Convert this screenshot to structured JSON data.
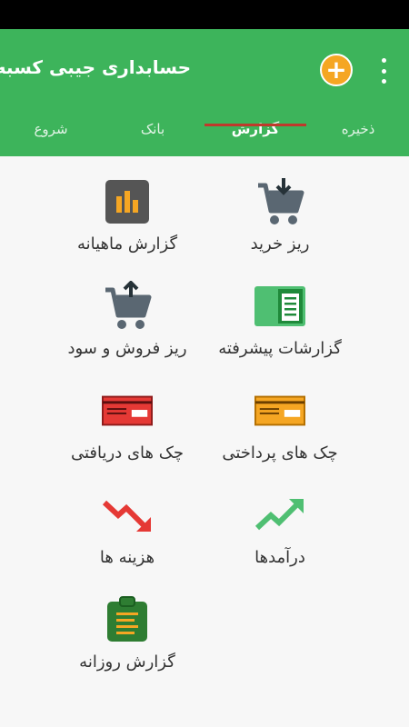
{
  "app": {
    "title": "حسابداری جیبی کسبه"
  },
  "toolbar": {
    "add_icon": "plus-circle-icon",
    "menu_icon": "more-vert-icon"
  },
  "tabs": [
    {
      "label": "ذخیره",
      "active": false
    },
    {
      "label": "گزارش",
      "active": true
    },
    {
      "label": "بانک",
      "active": false
    },
    {
      "label": "شروع",
      "active": false
    }
  ],
  "grid": {
    "items": [
      {
        "label": "ریز خرید",
        "icon": "cart-in-icon"
      },
      {
        "label": "گزارش ماهیانه",
        "icon": "bar-chart-icon"
      },
      {
        "label": "گزارشات پیشرفته",
        "icon": "report-sheet-icon"
      },
      {
        "label": "ریز فروش و سود",
        "icon": "cart-out-icon"
      },
      {
        "label": "چک های پرداختی",
        "icon": "check-paid-icon"
      },
      {
        "label": "چک های دریافتی",
        "icon": "check-received-icon"
      },
      {
        "label": "درآمدها",
        "icon": "trending-up-icon"
      },
      {
        "label": "هزینه ها",
        "icon": "trending-down-icon"
      },
      {
        "label": "گزارش روزانه",
        "icon": "daily-report-icon"
      }
    ]
  },
  "colors": {
    "primary": "#3db45b",
    "accent": "#f5a623",
    "indicator": "#c0392b"
  }
}
